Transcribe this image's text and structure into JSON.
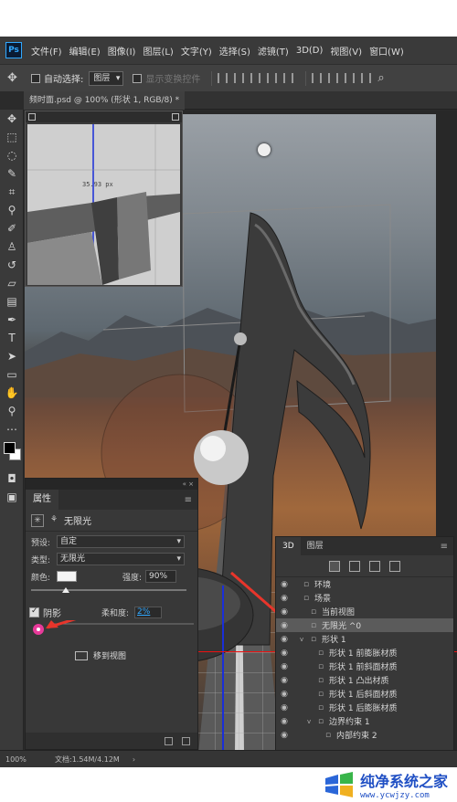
{
  "app": {
    "logo": "Ps"
  },
  "menubar": {
    "items": [
      "文件(F)",
      "编辑(E)",
      "图像(I)",
      "图层(L)",
      "文字(Y)",
      "选择(S)",
      "滤镜(T)",
      "3D(D)",
      "视图(V)",
      "窗口(W)"
    ]
  },
  "options": {
    "auto_select_label": "自动选择:",
    "auto_select_value": "图层",
    "show_transform_label": "显示变换控件"
  },
  "document": {
    "tab_title": "频时面.psd @ 100% (形状 1, RGB/8) *"
  },
  "navigator": {
    "readout": "35.93 px"
  },
  "properties": {
    "tab": "属性",
    "kind": "无限光",
    "preset_label": "预设:",
    "preset_value": "自定",
    "type_label": "类型:",
    "type_value": "无限光",
    "color_label": "颜色:",
    "intensity_label": "强度:",
    "intensity_value": "90%",
    "intensity_fraction": 0.9,
    "shadow_label": "阴影",
    "shadow_checked": true,
    "softness_label": "柔和度:",
    "softness_value": "2%",
    "move_to_view": "移到视图",
    "light_color": "#f4f4f4"
  },
  "panel3d": {
    "tabs": [
      "3D",
      "图层"
    ],
    "rows": [
      {
        "label": "环境",
        "indent": 0,
        "icon": "environment-icon",
        "twisty": "",
        "selected": false
      },
      {
        "label": "场景",
        "indent": 0,
        "icon": "scene-icon",
        "twisty": "",
        "selected": false
      },
      {
        "label": "当前视图",
        "indent": 1,
        "icon": "camera-icon",
        "twisty": "",
        "selected": false
      },
      {
        "label": "无限光 ^0",
        "indent": 1,
        "icon": "infinite-light-icon",
        "twisty": "",
        "selected": true
      },
      {
        "label": "形状 1",
        "indent": 1,
        "icon": "mesh-icon",
        "twisty": "v",
        "selected": false
      },
      {
        "label": "形状 1 前膨胀材质",
        "indent": 2,
        "icon": "material-icon",
        "twisty": "",
        "selected": false
      },
      {
        "label": "形状 1 前斜面材质",
        "indent": 2,
        "icon": "material-icon",
        "twisty": "",
        "selected": false
      },
      {
        "label": "形状 1 凸出材质",
        "indent": 2,
        "icon": "material-icon",
        "twisty": "",
        "selected": false
      },
      {
        "label": "形状 1 后斜面材质",
        "indent": 2,
        "icon": "material-icon",
        "twisty": "",
        "selected": false
      },
      {
        "label": "形状 1 后膨胀材质",
        "indent": 2,
        "icon": "material-icon",
        "twisty": "",
        "selected": false
      },
      {
        "label": "边界约束 1",
        "indent": 2,
        "icon": "constraint-icon",
        "twisty": "v",
        "selected": false
      },
      {
        "label": "内部约束 2",
        "indent": 3,
        "icon": "constraint-icon",
        "twisty": "",
        "selected": false
      }
    ]
  },
  "status": {
    "zoom": "100%",
    "doc": "文档:1.54M/4.12M"
  },
  "watermark": {
    "title": "纯净系统之家",
    "url": "www.ycwjzy.com"
  },
  "colors": {
    "accent": "#31a8ff",
    "arrow": "#e8352b",
    "selected_row": "#5b5b5b"
  }
}
